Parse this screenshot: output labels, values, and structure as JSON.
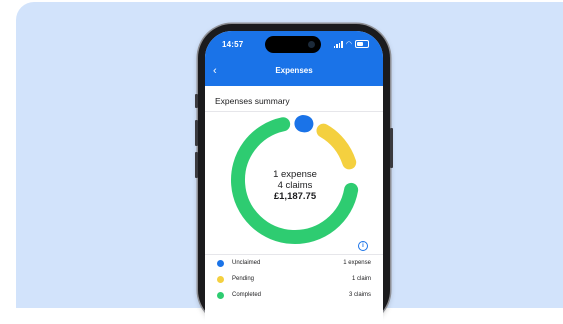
{
  "status_bar": {
    "time": "14:57"
  },
  "nav": {
    "back_glyph": "‹",
    "title": "Expenses"
  },
  "summary": {
    "title": "Expenses summary",
    "center_line1": "1 expense",
    "center_line2": "4 claims",
    "center_total": "£1,187.75"
  },
  "legend": [
    {
      "label": "Unclaimed",
      "value": "1 expense",
      "color": "#1a73e8"
    },
    {
      "label": "Pending",
      "value": "1 claim",
      "color": "#f4d03f"
    },
    {
      "label": "Completed",
      "value": "3 claims",
      "color": "#2ecc71"
    }
  ],
  "colors": {
    "accent": "#1a73e8",
    "background": "#d2e3fb",
    "unclaimed": "#1a73e8",
    "pending": "#f4d03f",
    "completed": "#2ecc71"
  },
  "icons": [
    "back-chevron-icon",
    "signal-icon",
    "wifi-icon",
    "battery-icon",
    "info-icon"
  ]
}
